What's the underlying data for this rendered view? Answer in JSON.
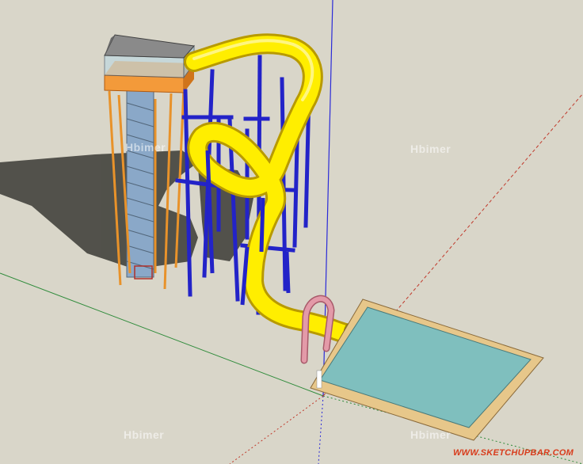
{
  "viewport": {
    "background_color": "#d9d6c9",
    "axes": {
      "red": "#c0392b",
      "green": "#2e8b3a",
      "blue": "#2a2ad8"
    }
  },
  "model": {
    "components": [
      {
        "name": "tower-cabin",
        "color": "#f08c2a",
        "roof_color": "#8a8a8a"
      },
      {
        "name": "spiral-stair-column",
        "color": "#8aa8c8"
      },
      {
        "name": "yellow-slide-tube",
        "color": "#ffee00"
      },
      {
        "name": "blue-support-frame",
        "color": "#2323c8"
      },
      {
        "name": "pink-arch",
        "color": "#e39aa8"
      },
      {
        "name": "splash-pool",
        "water_color": "#7fbfbe",
        "rim_color": "#e7c78a"
      }
    ]
  },
  "watermarks": {
    "brand": "Hbimer"
  },
  "credit": {
    "url": "WWW.SKETCHUPBAR.COM"
  }
}
